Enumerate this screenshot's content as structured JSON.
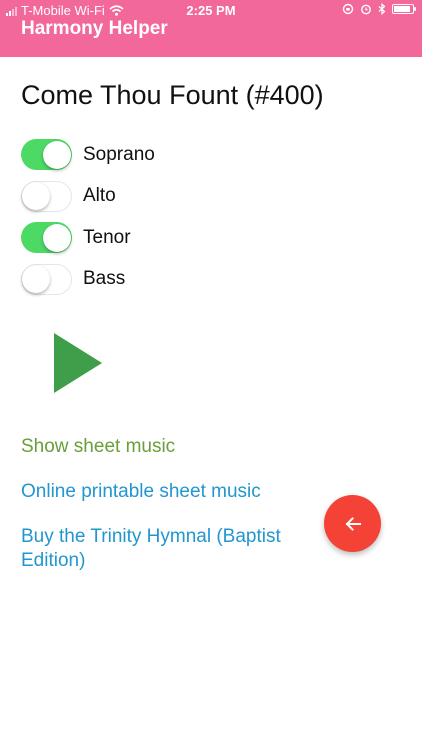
{
  "status_bar": {
    "carrier": "T-Mobile Wi-Fi",
    "time": "2:25 PM",
    "battery_level": 0.9
  },
  "app_bar": {
    "title": "Harmony Helper",
    "color": "#f2689a"
  },
  "hymn": {
    "title": "Come Thou Fount (#400)"
  },
  "voices": [
    {
      "label": "Soprano",
      "enabled": true
    },
    {
      "label": "Alto",
      "enabled": false
    },
    {
      "label": "Tenor",
      "enabled": true
    },
    {
      "label": "Bass",
      "enabled": false
    }
  ],
  "play": {
    "icon": "play-icon",
    "color": "#3f9e4a"
  },
  "links": {
    "show_sheet_music": "Show sheet music",
    "online_sheet_music": "Online printable sheet music",
    "buy_hymnal": "Buy the Trinity Hymnal (Baptist Edition)"
  },
  "fab": {
    "icon": "arrow-left-icon",
    "color": "#f44336"
  }
}
